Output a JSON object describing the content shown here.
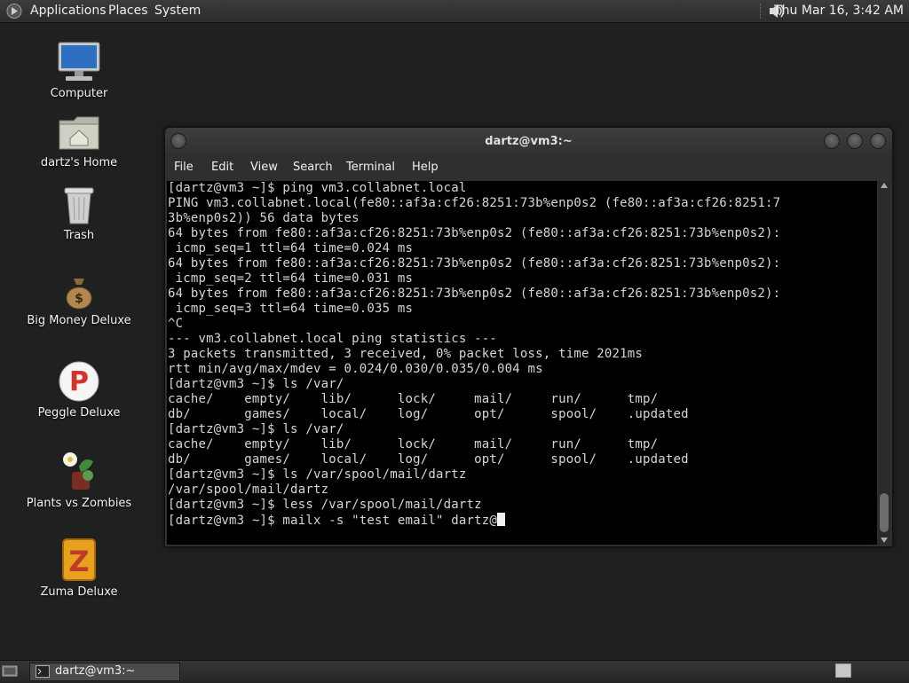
{
  "top_panel": {
    "menus": [
      "Applications",
      "Places",
      "System"
    ],
    "clock": "Thu Mar 16,  3:42 AM"
  },
  "desktop_icons": [
    {
      "label": "Computer",
      "icon": "computer-icon"
    },
    {
      "label": "dartz's Home",
      "icon": "home-folder-icon"
    },
    {
      "label": "Trash",
      "icon": "trash-icon"
    },
    {
      "label": "Big Money Deluxe",
      "icon": "money-bag-icon"
    },
    {
      "label": "Peggle Deluxe",
      "icon": "peggle-icon"
    },
    {
      "label": "Plants vs Zombies",
      "icon": "plants-vs-zombies-icon"
    },
    {
      "label": "Zuma Deluxe",
      "icon": "zuma-icon"
    }
  ],
  "terminal": {
    "title": "dartz@vm3:~",
    "menu": [
      "File",
      "Edit",
      "View",
      "Search",
      "Terminal",
      "Help"
    ],
    "lines": [
      "[dartz@vm3 ~]$ ping vm3.collabnet.local",
      "PING vm3.collabnet.local(fe80::af3a:cf26:8251:73b%enp0s2 (fe80::af3a:cf26:8251:7",
      "3b%enp0s2)) 56 data bytes",
      "64 bytes from fe80::af3a:cf26:8251:73b%enp0s2 (fe80::af3a:cf26:8251:73b%enp0s2):",
      " icmp_seq=1 ttl=64 time=0.024 ms",
      "64 bytes from fe80::af3a:cf26:8251:73b%enp0s2 (fe80::af3a:cf26:8251:73b%enp0s2):",
      " icmp_seq=2 ttl=64 time=0.031 ms",
      "64 bytes from fe80::af3a:cf26:8251:73b%enp0s2 (fe80::af3a:cf26:8251:73b%enp0s2):",
      " icmp_seq=3 ttl=64 time=0.035 ms",
      "^C",
      "--- vm3.collabnet.local ping statistics ---",
      "3 packets transmitted, 3 received, 0% packet loss, time 2021ms",
      "rtt min/avg/max/mdev = 0.024/0.030/0.035/0.004 ms",
      "[dartz@vm3 ~]$ ls /var/",
      "cache/    empty/    lib/      lock/     mail/     run/      tmp/",
      "db/       games/    local/    log/      opt/      spool/    .updated",
      "[dartz@vm3 ~]$ ls /var/",
      "cache/    empty/    lib/      lock/     mail/     run/      tmp/",
      "db/       games/    local/    log/      opt/      spool/    .updated",
      "[dartz@vm3 ~]$ ls /var/spool/mail/dartz",
      "/var/spool/mail/dartz",
      "[dartz@vm3 ~]$ less /var/spool/mail/dartz"
    ],
    "prompt_line": "[dartz@vm3 ~]$ mailx -s \"test email\" dartz@"
  },
  "bottom_panel": {
    "task_label": "dartz@vm3:~"
  }
}
